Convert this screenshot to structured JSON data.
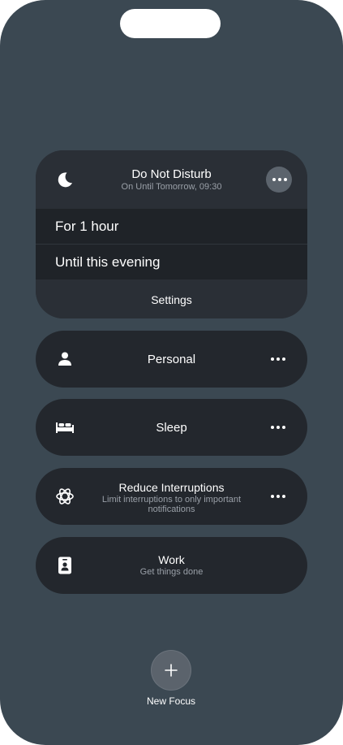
{
  "dnd": {
    "title": "Do Not Disturb",
    "subtitle": "On Until Tomorrow, 09:30",
    "icon": "moon-icon",
    "options": [
      "For 1 hour",
      "Until this evening"
    ],
    "settings_label": "Settings"
  },
  "focus_modes": [
    {
      "title": "Personal",
      "subtitle": "",
      "icon": "person-icon",
      "has_more": true
    },
    {
      "title": "Sleep",
      "subtitle": "",
      "icon": "bed-icon",
      "has_more": true
    },
    {
      "title": "Reduce Interruptions",
      "subtitle": "Limit interruptions to only important notifications",
      "icon": "reduce-interruptions-icon",
      "has_more": true
    },
    {
      "title": "Work",
      "subtitle": "Get things done",
      "icon": "badge-icon",
      "has_more": false
    }
  ],
  "new_focus": {
    "label": "New Focus",
    "icon": "plus-icon"
  },
  "colors": {
    "background": "#3b4852",
    "card": "#23272d",
    "accent_text": "#ffffff",
    "secondary_text": "#9aa0a8"
  }
}
